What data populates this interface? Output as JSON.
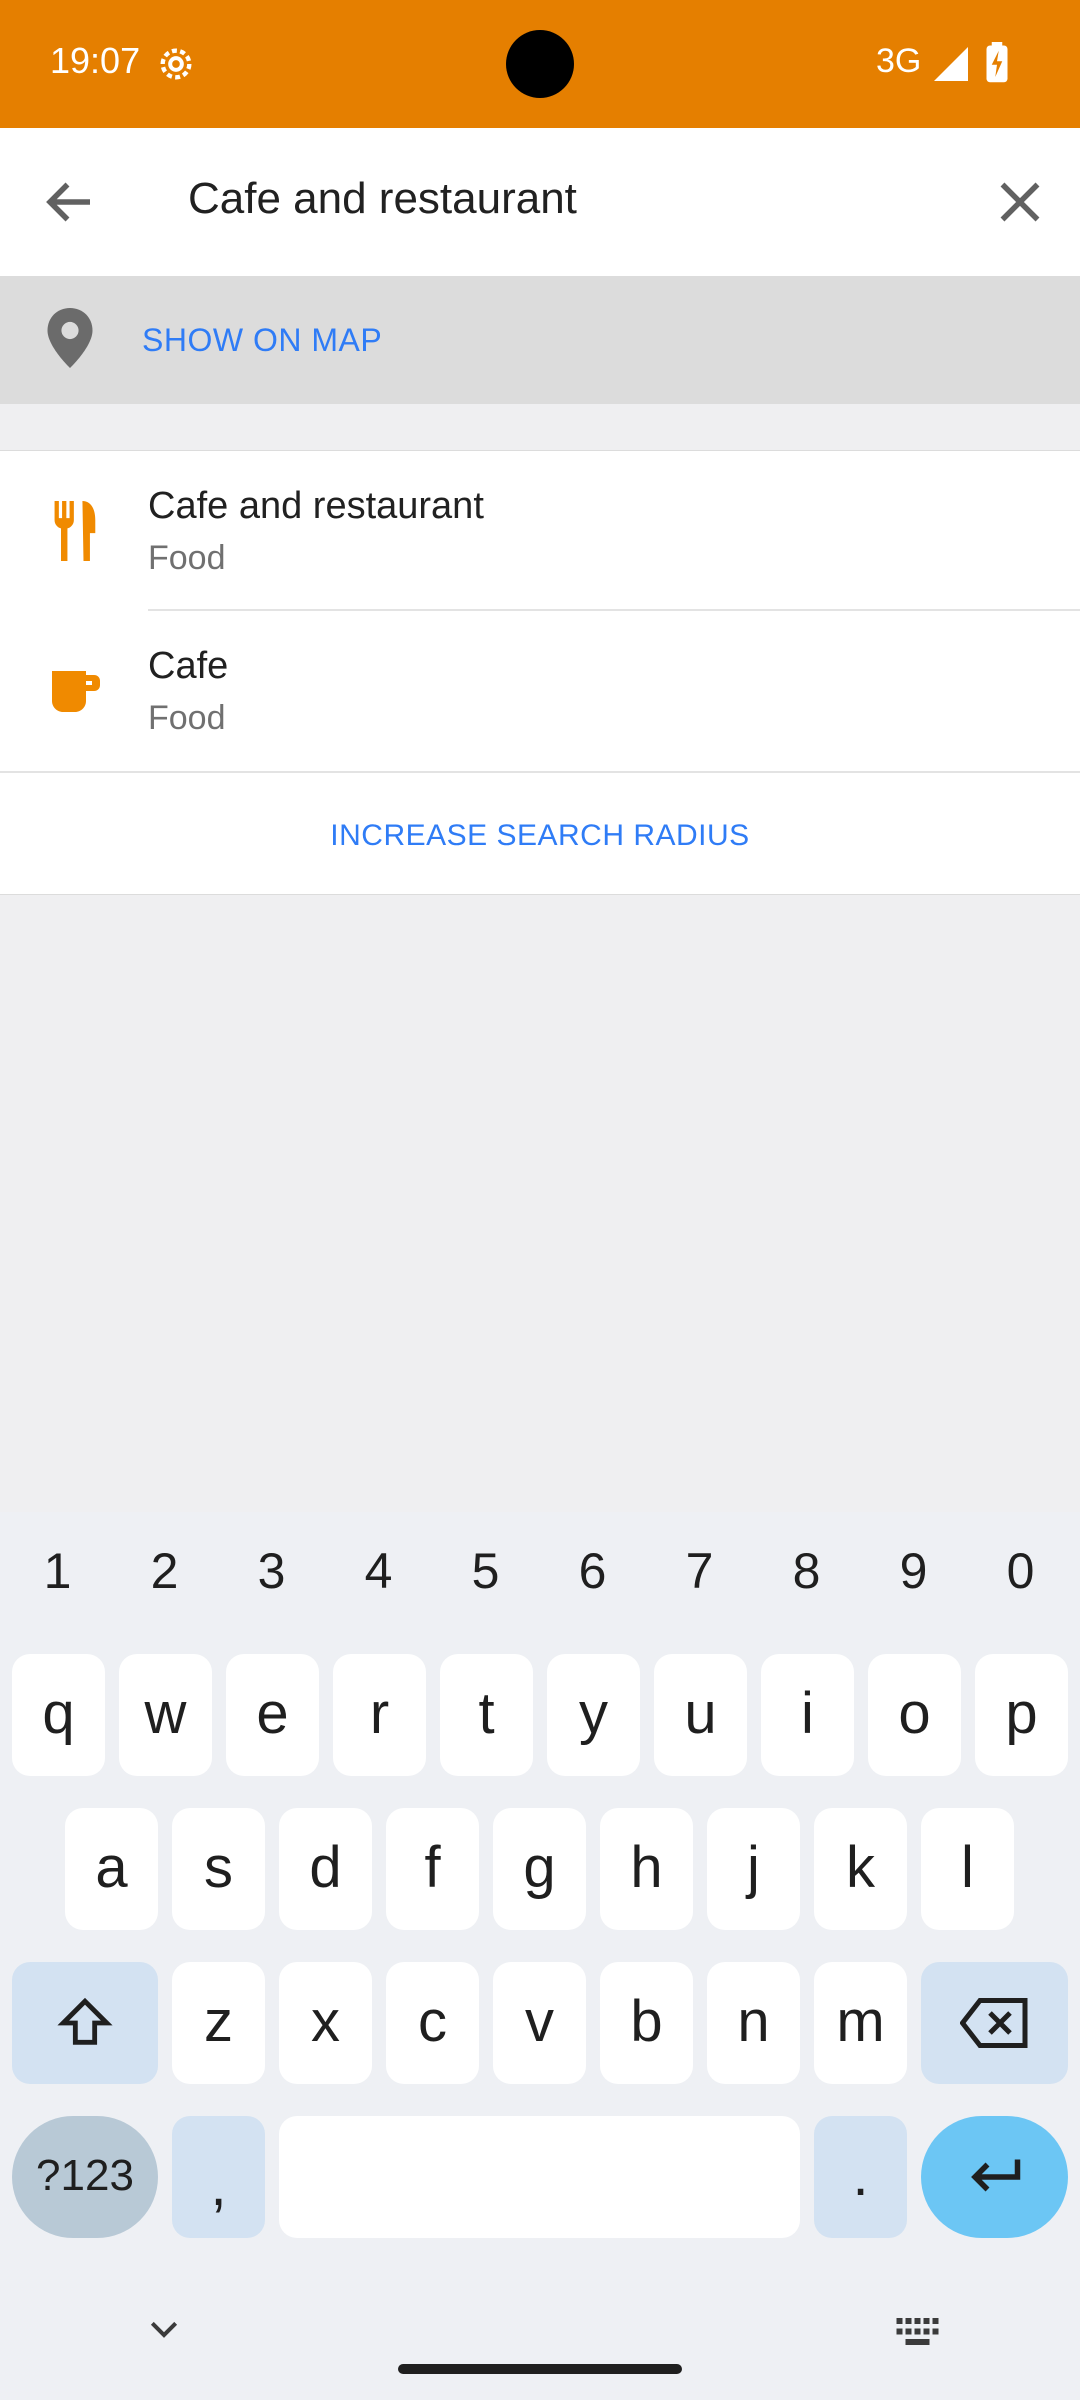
{
  "status_bar": {
    "time": "19:07",
    "network": "3G"
  },
  "search": {
    "query": "Cafe and restaurant"
  },
  "show_on_map": {
    "label": "SHOW ON MAP"
  },
  "results": [
    {
      "title": "Cafe and restaurant",
      "category": "Food",
      "icon": "fork-knife-icon"
    },
    {
      "title": "Cafe",
      "category": "Food",
      "icon": "coffee-cup-icon"
    }
  ],
  "increase_radius": {
    "label": "INCREASE SEARCH RADIUS"
  },
  "colors": {
    "accent": "#e57f00",
    "link": "#2f7cf6"
  },
  "keyboard": {
    "numbers": [
      "1",
      "2",
      "3",
      "4",
      "5",
      "6",
      "7",
      "8",
      "9",
      "0"
    ],
    "row1": [
      "q",
      "w",
      "e",
      "r",
      "t",
      "y",
      "u",
      "i",
      "o",
      "p"
    ],
    "row2": [
      "a",
      "s",
      "d",
      "f",
      "g",
      "h",
      "j",
      "k",
      "l"
    ],
    "row3": [
      "z",
      "x",
      "c",
      "v",
      "b",
      "n",
      "m"
    ],
    "symbols_label": "?123",
    "comma": ",",
    "period": "."
  }
}
